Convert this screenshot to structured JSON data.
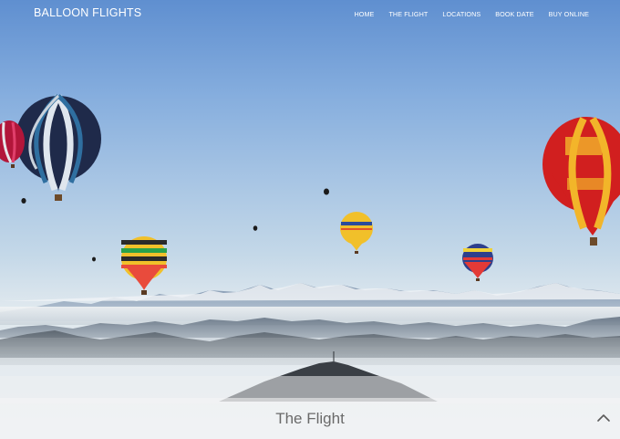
{
  "navbar": {
    "brand": "BALLOON FLIGHTS",
    "links": [
      {
        "label": "HOME"
      },
      {
        "label": "THE FLIGHT"
      },
      {
        "label": "LOCATIONS"
      },
      {
        "label": "BOOK DATE"
      },
      {
        "label": "BUY ONLINE"
      }
    ]
  },
  "hero": {
    "image": "hot-air-balloons-over-misty-mountains"
  },
  "section": {
    "title": "The Flight"
  },
  "icons": {
    "scroll_up": "chevron-up-icon"
  }
}
